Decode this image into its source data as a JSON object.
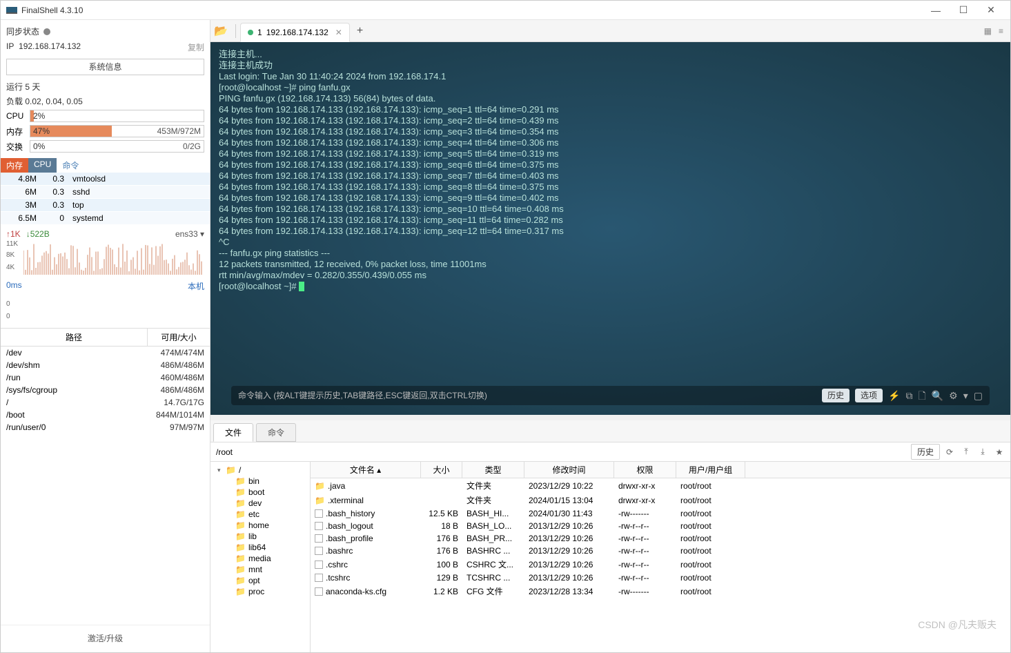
{
  "app": {
    "title": "FinalShell 4.3.10"
  },
  "win_controls": {
    "min": "—",
    "max": "☐",
    "close": "✕"
  },
  "left": {
    "sync_label": "同步状态",
    "ip_label": "IP",
    "ip": "192.168.174.132",
    "copy": "复制",
    "sysinfo_btn": "系统信息",
    "uptime": "运行 5 天",
    "load": "负载 0.02, 0.04, 0.05",
    "cpu": {
      "label": "CPU",
      "pct": "2%",
      "fill": 2
    },
    "mem": {
      "label": "内存",
      "pct": "47%",
      "right": "453M/972M",
      "fill": 47
    },
    "swap": {
      "label": "交换",
      "pct": "0%",
      "right": "0/2G",
      "fill": 0
    },
    "proc_head": {
      "mem": "内存",
      "cpu": "CPU",
      "cmd": "命令"
    },
    "procs": [
      {
        "mem": "4.8M",
        "cpu": "0.3",
        "cmd": "vmtoolsd"
      },
      {
        "mem": "6M",
        "cpu": "0.3",
        "cmd": "sshd"
      },
      {
        "mem": "3M",
        "cpu": "0.3",
        "cmd": "top"
      },
      {
        "mem": "6.5M",
        "cpu": "0",
        "cmd": "systemd"
      }
    ],
    "net": {
      "up": "↑1K",
      "down": "↓522B",
      "iface": "ens33 ▾",
      "ticks": [
        "11K",
        "8K",
        "4K"
      ]
    },
    "lat": {
      "ms": "0ms",
      "local": "本机",
      "ticks": [
        "0",
        "0"
      ]
    },
    "path_head": {
      "p": "路径",
      "s": "可用/大小"
    },
    "paths": [
      {
        "p": "/dev",
        "s": "474M/474M"
      },
      {
        "p": "/dev/shm",
        "s": "486M/486M"
      },
      {
        "p": "/run",
        "s": "460M/486M"
      },
      {
        "p": "/sys/fs/cgroup",
        "s": "486M/486M"
      },
      {
        "p": "/",
        "s": "14.7G/17G"
      },
      {
        "p": "/boot",
        "s": "844M/1014M"
      },
      {
        "p": "/run/user/0",
        "s": "97M/97M"
      }
    ],
    "activate": "激活/升级"
  },
  "tabbar": {
    "tab_num": "1",
    "tab_title": "192.168.174.132"
  },
  "terminal": {
    "lines": [
      "连接主机...",
      "连接主机成功",
      "Last login: Tue Jan 30 11:40:24 2024 from 192.168.174.1",
      "[root@localhost ~]# ping fanfu.gx",
      "PING fanfu.gx (192.168.174.133) 56(84) bytes of data.",
      "64 bytes from 192.168.174.133 (192.168.174.133): icmp_seq=1 ttl=64 time=0.291 ms",
      "64 bytes from 192.168.174.133 (192.168.174.133): icmp_seq=2 ttl=64 time=0.439 ms",
      "64 bytes from 192.168.174.133 (192.168.174.133): icmp_seq=3 ttl=64 time=0.354 ms",
      "64 bytes from 192.168.174.133 (192.168.174.133): icmp_seq=4 ttl=64 time=0.306 ms",
      "64 bytes from 192.168.174.133 (192.168.174.133): icmp_seq=5 ttl=64 time=0.319 ms",
      "64 bytes from 192.168.174.133 (192.168.174.133): icmp_seq=6 ttl=64 time=0.375 ms",
      "64 bytes from 192.168.174.133 (192.168.174.133): icmp_seq=7 ttl=64 time=0.403 ms",
      "64 bytes from 192.168.174.133 (192.168.174.133): icmp_seq=8 ttl=64 time=0.375 ms",
      "64 bytes from 192.168.174.133 (192.168.174.133): icmp_seq=9 ttl=64 time=0.402 ms",
      "64 bytes from 192.168.174.133 (192.168.174.133): icmp_seq=10 ttl=64 time=0.408 ms",
      "64 bytes from 192.168.174.133 (192.168.174.133): icmp_seq=11 ttl=64 time=0.282 ms",
      "64 bytes from 192.168.174.133 (192.168.174.133): icmp_seq=12 ttl=64 time=0.317 ms",
      "^C",
      "--- fanfu.gx ping statistics ---",
      "12 packets transmitted, 12 received, 0% packet loss, time 11001ms",
      "rtt min/avg/max/mdev = 0.282/0.355/0.439/0.055 ms",
      "[root@localhost ~]# "
    ]
  },
  "cmdbar": {
    "hint": "命令输入 (按ALT键提示历史,TAB键路径,ESC键返回,双击CTRL切换)",
    "history": "历史",
    "options": "选项"
  },
  "bottom_tabs": {
    "files": "文件",
    "cmds": "命令"
  },
  "pathbar": {
    "path": "/root",
    "history": "历史"
  },
  "tree": [
    "/",
    "bin",
    "boot",
    "dev",
    "etc",
    "home",
    "lib",
    "lib64",
    "media",
    "mnt",
    "opt",
    "proc"
  ],
  "file_head": {
    "name": "文件名 ▴",
    "size": "大小",
    "type": "类型",
    "date": "修改时间",
    "perm": "权限",
    "user": "用户/用户组"
  },
  "files": [
    {
      "icon": "folder",
      "name": ".java",
      "size": "",
      "type": "文件夹",
      "date": "2023/12/29 10:22",
      "perm": "drwxr-xr-x",
      "user": "root/root"
    },
    {
      "icon": "folder",
      "name": ".xterminal",
      "size": "",
      "type": "文件夹",
      "date": "2024/01/15 13:04",
      "perm": "drwxr-xr-x",
      "user": "root/root"
    },
    {
      "icon": "file",
      "name": ".bash_history",
      "size": "12.5 KB",
      "type": "BASH_HI...",
      "date": "2024/01/30 11:43",
      "perm": "-rw-------",
      "user": "root/root"
    },
    {
      "icon": "file",
      "name": ".bash_logout",
      "size": "18 B",
      "type": "BASH_LO...",
      "date": "2013/12/29 10:26",
      "perm": "-rw-r--r--",
      "user": "root/root"
    },
    {
      "icon": "file",
      "name": ".bash_profile",
      "size": "176 B",
      "type": "BASH_PR...",
      "date": "2013/12/29 10:26",
      "perm": "-rw-r--r--",
      "user": "root/root"
    },
    {
      "icon": "file",
      "name": ".bashrc",
      "size": "176 B",
      "type": "BASHRC ...",
      "date": "2013/12/29 10:26",
      "perm": "-rw-r--r--",
      "user": "root/root"
    },
    {
      "icon": "file",
      "name": ".cshrc",
      "size": "100 B",
      "type": "CSHRC 文...",
      "date": "2013/12/29 10:26",
      "perm": "-rw-r--r--",
      "user": "root/root"
    },
    {
      "icon": "file",
      "name": ".tcshrc",
      "size": "129 B",
      "type": "TCSHRC ...",
      "date": "2013/12/29 10:26",
      "perm": "-rw-r--r--",
      "user": "root/root"
    },
    {
      "icon": "file",
      "name": "anaconda-ks.cfg",
      "size": "1.2 KB",
      "type": "CFG 文件",
      "date": "2023/12/28 13:34",
      "perm": "-rw-------",
      "user": "root/root"
    }
  ],
  "watermark": "CSDN @凡夫贩夫"
}
